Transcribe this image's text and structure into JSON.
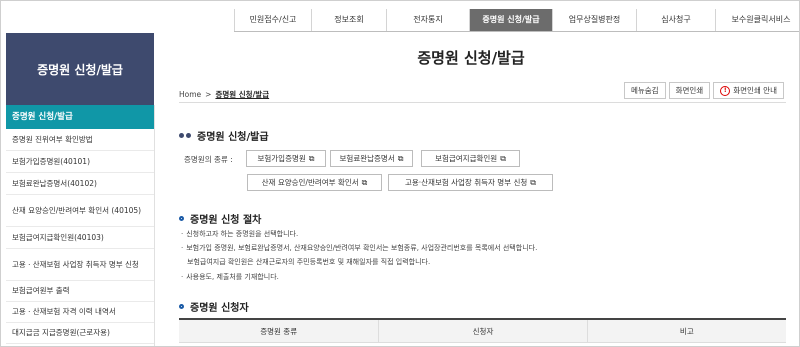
{
  "topnav": {
    "tabs": [
      {
        "label": "민원접수/신고",
        "active": false
      },
      {
        "label": "정보조회",
        "active": false
      },
      {
        "label": "전자통지",
        "active": false
      },
      {
        "label": "증명원 신청/발급",
        "active": true
      },
      {
        "label": "업무상질병판정",
        "active": false
      },
      {
        "label": "심사청구",
        "active": false
      },
      {
        "label": "보수원클릭서비스",
        "active": false
      }
    ]
  },
  "sidebar": {
    "title": "증명원 신청/발급",
    "items": [
      {
        "label": "증명원 신청/발급",
        "active": true
      },
      {
        "label": "증명원 진위여부 확인방법",
        "active": false
      },
      {
        "label": "보험가입증명원(40101)",
        "active": false
      },
      {
        "label": "보험료완납증명서(40102)",
        "active": false
      },
      {
        "label": "산재 요양승인/반려여부 확인서 (40105)",
        "active": false
      },
      {
        "label": "보험급여지급확인원(40103)",
        "active": false
      },
      {
        "label": "고용ㆍ산재보험 사업장 취득자 명부 신청",
        "active": false
      },
      {
        "label": "보험급여원부 출력",
        "active": false
      },
      {
        "label": "고용ㆍ산재보험 자격 이력 내역서",
        "active": false
      },
      {
        "label": "대지급금 지급증명원(근로자용)",
        "active": false
      }
    ]
  },
  "main": {
    "title": "증명원 신청/발급",
    "breadcrumb": {
      "home": "Home",
      "separator": ">",
      "current": "증명원 신청/발급"
    },
    "tools": {
      "menu_hide": "메뉴숨김",
      "print": "화면인쇄",
      "print_guide": "화면인쇄 안내"
    },
    "section1": {
      "title": "증명원 신청/발급",
      "cert_label": "증명원의 종류 :",
      "certs": [
        "보험가입증명원",
        "보험료완납증명서",
        "보험급여지급확인원",
        "산재 요양승인/반려여부 확인서",
        "고용·산재보험 사업장 취득자 명부 신청"
      ]
    },
    "section2": {
      "title": "증명원 신청 절차",
      "steps": [
        "신청하고자 하는 증명원을 선택합니다.",
        "보험가입 증명원, 보험료완납증명서, 산재요양승인/반려여부 확인서는 보험종류, 사업장관리번호를 목록에서 선택합니다.",
        "보험급여지급 확인원은 산재근로자의 주민등록번호 및 재해일자를 직접 입력합니다.",
        "사용용도, 제출처를 기재합니다."
      ]
    },
    "section3": {
      "title": "증명원 신청자",
      "columns": [
        "증명원 종류",
        "신청자",
        "비고"
      ]
    }
  }
}
